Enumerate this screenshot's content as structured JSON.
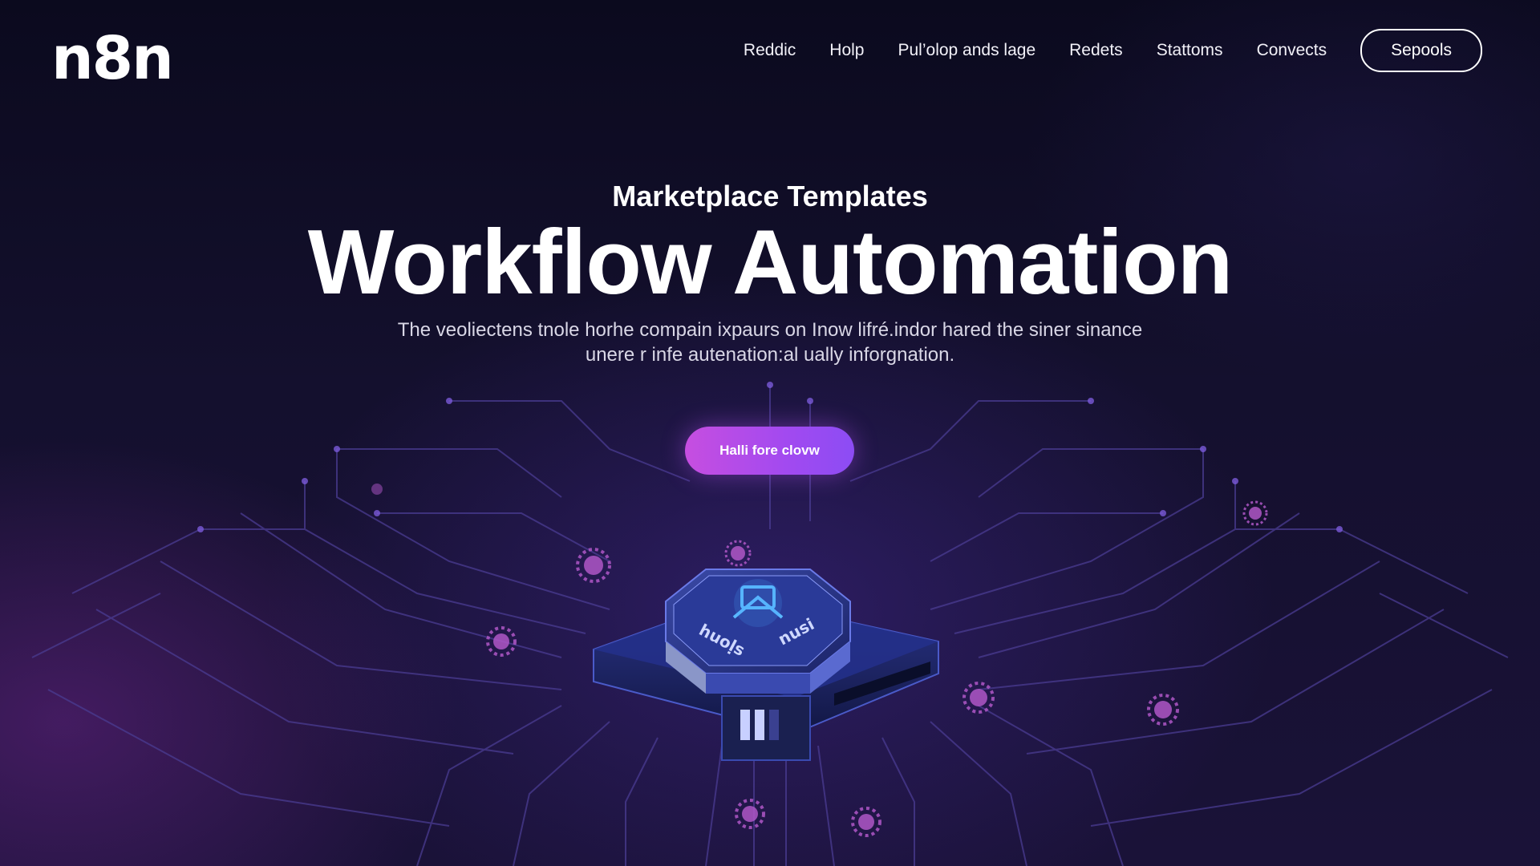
{
  "brand": {
    "logo_text": "n8n"
  },
  "nav": {
    "items": [
      {
        "label": "Reddic"
      },
      {
        "label": "Holp"
      },
      {
        "label": "Pul’olop ands lage"
      },
      {
        "label": "Redets"
      },
      {
        "label": "Stattoms"
      },
      {
        "label": "Convects"
      }
    ],
    "cta_label": "Sepools"
  },
  "hero": {
    "eyebrow": "Marketplace Templates",
    "headline": "Workflow Automation",
    "subtext_line1": "The veoliectens tnole horhe compain ixpaurs on Inow lifré.indor hared the siner sinance",
    "subtext_line2": "unere r infe autenation:al ually inforgnation.",
    "cta_label": "Halli fore clovw"
  },
  "chip": {
    "left_text": "huoḷs",
    "right_text": "nusi"
  },
  "colors": {
    "background": "#0b0a1c",
    "accent_pink": "#c64ee0",
    "accent_purple": "#8c4cf4",
    "circuit": "#5a4aa8",
    "chip_glow": "#4aa8ff"
  },
  "icons": {
    "chip_icon": "workflow-chip-icon",
    "node_icon": "gear-node-icon"
  }
}
